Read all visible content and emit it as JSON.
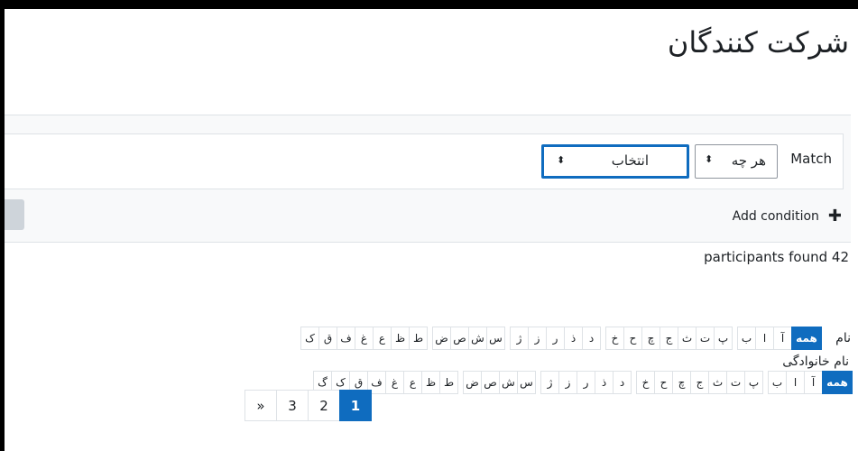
{
  "page": {
    "title": "شرکت کنندگان"
  },
  "filter": {
    "match_label": "Match",
    "jointype": {
      "value": "هر چه"
    },
    "type_select": {
      "value": "انتخاب"
    },
    "add_condition_label": "Add condition"
  },
  "participants": {
    "count_text": "participants found 42"
  },
  "initials": {
    "firstname_label": "نام",
    "lastname_label": "نام خانوادگی",
    "all_label": "همه",
    "firstname_letters": [
      "آ",
      "ا",
      "ب",
      "پ",
      "ت",
      "ث",
      "ج",
      "چ",
      "ح",
      "خ",
      "د",
      "ذ",
      "ر",
      "ز",
      "ژ",
      "س",
      "ش",
      "ص",
      "ض",
      "ط",
      "ظ",
      "ع",
      "غ",
      "ف",
      "ق",
      "ک"
    ],
    "lastname_letters": [
      "آ",
      "ا",
      "ب",
      "پ",
      "ت",
      "ث",
      "ج",
      "چ",
      "ح",
      "خ",
      "د",
      "ذ",
      "ر",
      "ز",
      "ژ",
      "س",
      "ش",
      "ص",
      "ض",
      "ط",
      "ظ",
      "ع",
      "غ",
      "ف",
      "ق",
      "ک",
      "گ"
    ]
  },
  "pagination": {
    "pages": [
      "1",
      "2",
      "3"
    ],
    "next_label": "»",
    "active": "1"
  },
  "colors": {
    "accent": "#0f6cbf",
    "panel": "#f8f9fa",
    "border": "#dee2e6"
  },
  "icons": {
    "plus": "plus-icon",
    "select_arrow": "sort-arrows-icon"
  }
}
